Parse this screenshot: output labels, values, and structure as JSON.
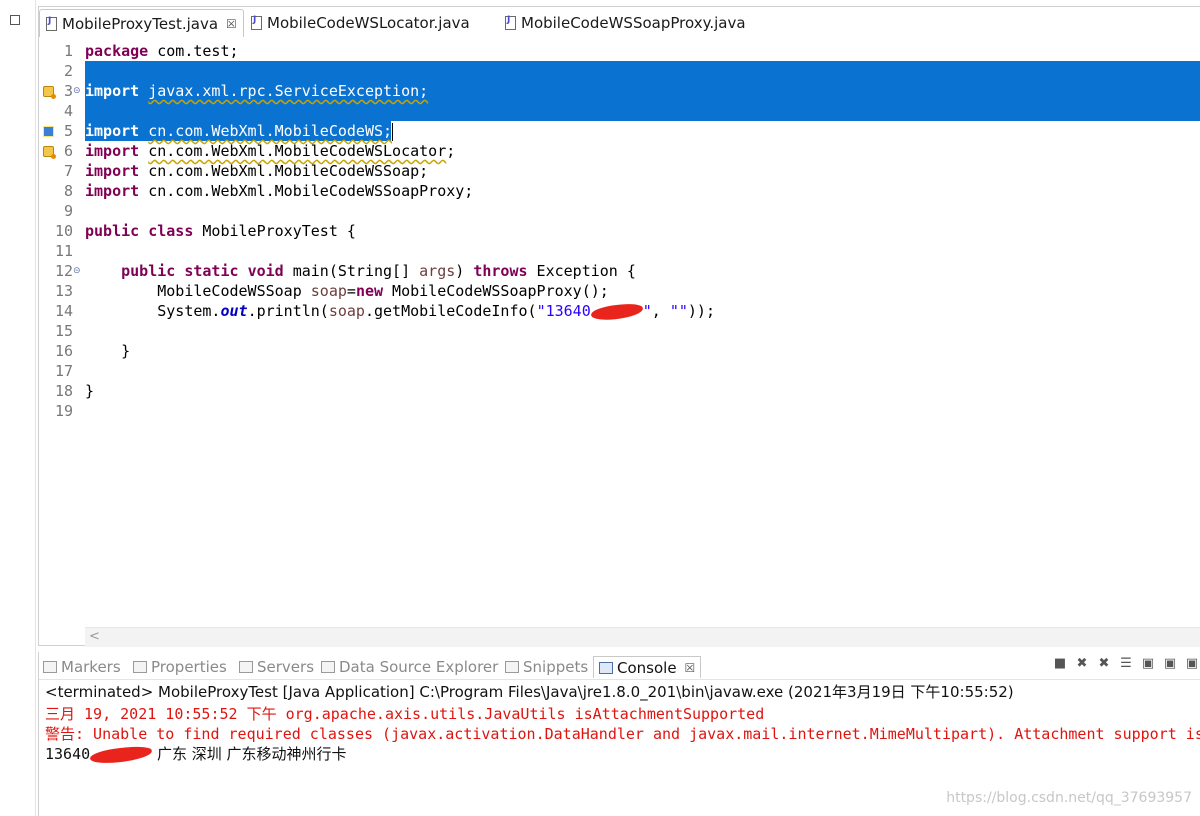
{
  "editor": {
    "tabs": [
      {
        "label": "MobileProxyTest.java",
        "active": true,
        "close": "☒"
      },
      {
        "label": "MobileCodeWSLocator.java",
        "active": false
      },
      {
        "label": "MobileCodeWSSoapProxy.java",
        "active": false
      }
    ],
    "line_numbers": [
      "1",
      "2",
      "3",
      "4",
      "5",
      "6",
      "7",
      "8",
      "9",
      "10",
      "11",
      "12",
      "13",
      "14",
      "15",
      "16",
      "17",
      "18",
      "19"
    ],
    "lines": {
      "l1": {
        "kw": "package",
        "rest": " com.test;"
      },
      "l3": {
        "kw": "import",
        "pre": " ",
        "target": "javax.xml.rpc.ServiceException;"
      },
      "l5": {
        "kw": "import",
        "pre": " ",
        "target": "cn.com.WebXml.MobileCodeWS;"
      },
      "l6": {
        "kw": "import",
        "pre": " ",
        "target": "cn.com.WebXml.MobileCodeWSLocator",
        "post": ";"
      },
      "l7": {
        "kw": "import",
        "rest": " cn.com.WebXml.MobileCodeWSSoap;"
      },
      "l8": {
        "kw": "import",
        "rest": " cn.com.WebXml.MobileCodeWSSoapProxy;"
      },
      "l10": {
        "kw1": "public",
        "kw2": "class",
        "rest": " MobileProxyTest {"
      },
      "l12": {
        "indent": "    ",
        "kw1": "public",
        "kw2": "static",
        "kw3": "void",
        "mid": " main(String[] ",
        "var": "args",
        "mid2": ") ",
        "kw4": "throws",
        "rest": " Exception {"
      },
      "l13": {
        "indent": "        ",
        "type": "MobileCodeWSSoap ",
        "var": "soap",
        "eq": "=",
        "kw": "new",
        "rest": " MobileCodeWSSoapProxy();"
      },
      "l14": {
        "indent": "        ",
        "pre": "System.",
        "field": "out",
        "mid": ".println(",
        "var": "soap",
        "mid2": ".getMobileCodeInfo(",
        "str1": "\"13640",
        "str2": "\"",
        "sep": ", ",
        "str3": "\"\"",
        "rest": "));"
      },
      "l16": {
        "text": "    }"
      },
      "l18": {
        "text": "}"
      }
    },
    "scroll_arrow": "<"
  },
  "console": {
    "tabs": [
      {
        "label": "Markers",
        "icon": "markers-icon"
      },
      {
        "label": "Properties",
        "icon": "properties-icon"
      },
      {
        "label": "Servers",
        "icon": "servers-icon"
      },
      {
        "label": "Data Source Explorer",
        "icon": "data-source-icon"
      },
      {
        "label": "Snippets",
        "icon": "snippets-icon"
      },
      {
        "label": "Console",
        "icon": "console-icon",
        "active": true,
        "close": "☒"
      }
    ],
    "toolbar_glyphs": [
      "■",
      "✖",
      "✖",
      "☰",
      "▣",
      "▣",
      "▣"
    ],
    "terminated": "<terminated> MobileProxyTest [Java Application] C:\\Program Files\\Java\\jre1.8.0_201\\bin\\javaw.exe (2021年3月19日 下午10:55:52)",
    "err1": "三月 19, 2021 10:55:52 下午 org.apache.axis.utils.JavaUtils isAttachmentSupported",
    "err2": "警告: Unable to find required classes (javax.activation.DataHandler and javax.mail.internet.MimeMultipart). Attachment support is",
    "out_prefix": "13640",
    "out_result": "广东 深圳 广东移动神州行卡"
  },
  "watermark": "https://blog.csdn.net/qq_37693957",
  "colors": {
    "selection": "#0a72d1",
    "keyword": "#7f0055",
    "string": "#2a00ff",
    "error": "#e0140f"
  }
}
